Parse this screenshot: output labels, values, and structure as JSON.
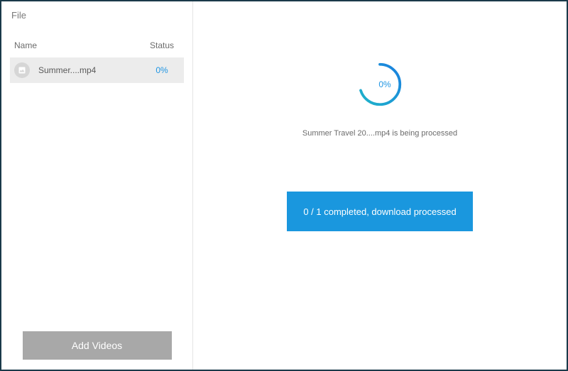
{
  "sidebar": {
    "title": "File",
    "headers": {
      "name": "Name",
      "status": "Status"
    },
    "files": [
      {
        "name": "Summer....mp4",
        "status": "0%"
      }
    ],
    "add_videos_label": "Add Videos"
  },
  "main": {
    "spinner_pct": "0%",
    "processing_text": "Summer Travel 20....mp4 is being processed",
    "download_label": "0 / 1 completed, download processed"
  },
  "colors": {
    "accent": "#1a97de",
    "border": "#1a3a4a"
  }
}
